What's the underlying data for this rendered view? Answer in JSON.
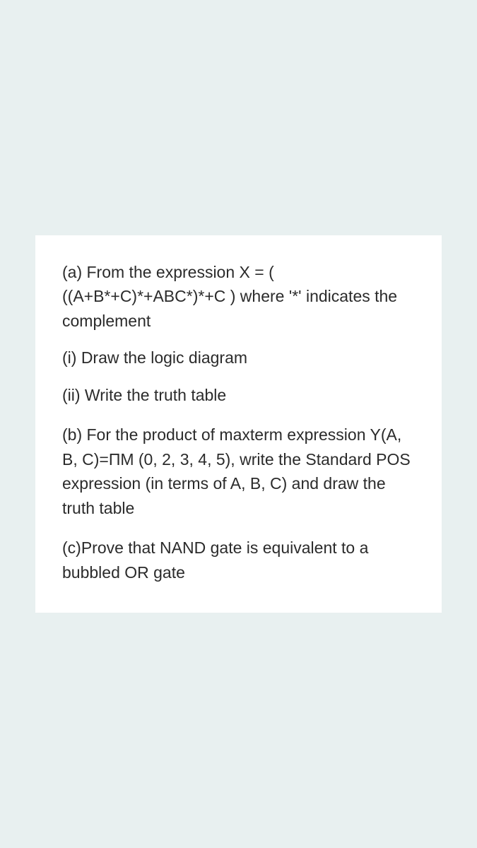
{
  "question": {
    "part_a": {
      "intro_line1": "(a) From the expression  X = (",
      "intro_line2": "((A+B*+C)*+ABC*)*+C ) where '*' indicates the complement",
      "sub_i": "(i) Draw the logic diagram",
      "sub_ii": "(ii) Write the truth table"
    },
    "part_b": {
      "text": "(b) For the product of maxterm expression Y(A, B, C)=ПM (0, 2, 3, 4, 5), write the Standard POS expression (in terms of A, B, C) and draw the truth table"
    },
    "part_c": {
      "text": "(c)Prove  that NAND gate is equivalent to a bubbled OR gate"
    }
  }
}
